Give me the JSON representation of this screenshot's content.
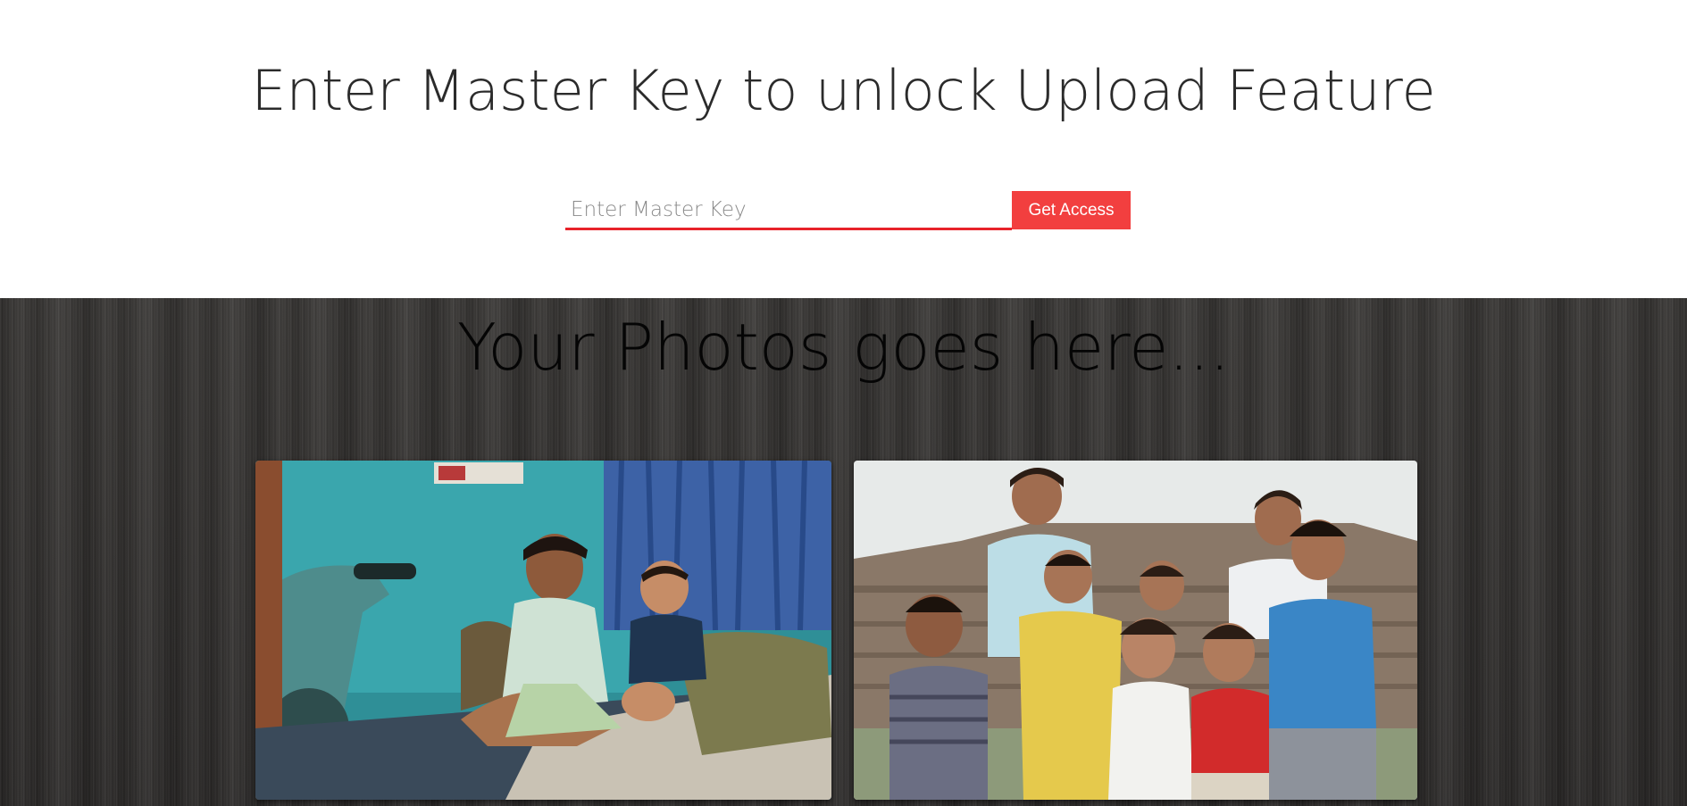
{
  "unlock": {
    "heading": "Enter Master Key to unlock Upload Feature",
    "input_placeholder": "Enter Master Key",
    "input_value": "",
    "button_label": "Get Access"
  },
  "gallery": {
    "title": "Your Photos goes here...",
    "photos": [
      {
        "subject": "two children sitting on a bed"
      },
      {
        "subject": "group of children standing outdoors"
      }
    ]
  },
  "colors": {
    "accent": "#f23f3f",
    "underline": "#e8222a",
    "gallery_bg": "#2f2d2c",
    "heading_text": "#2b2b2b"
  }
}
